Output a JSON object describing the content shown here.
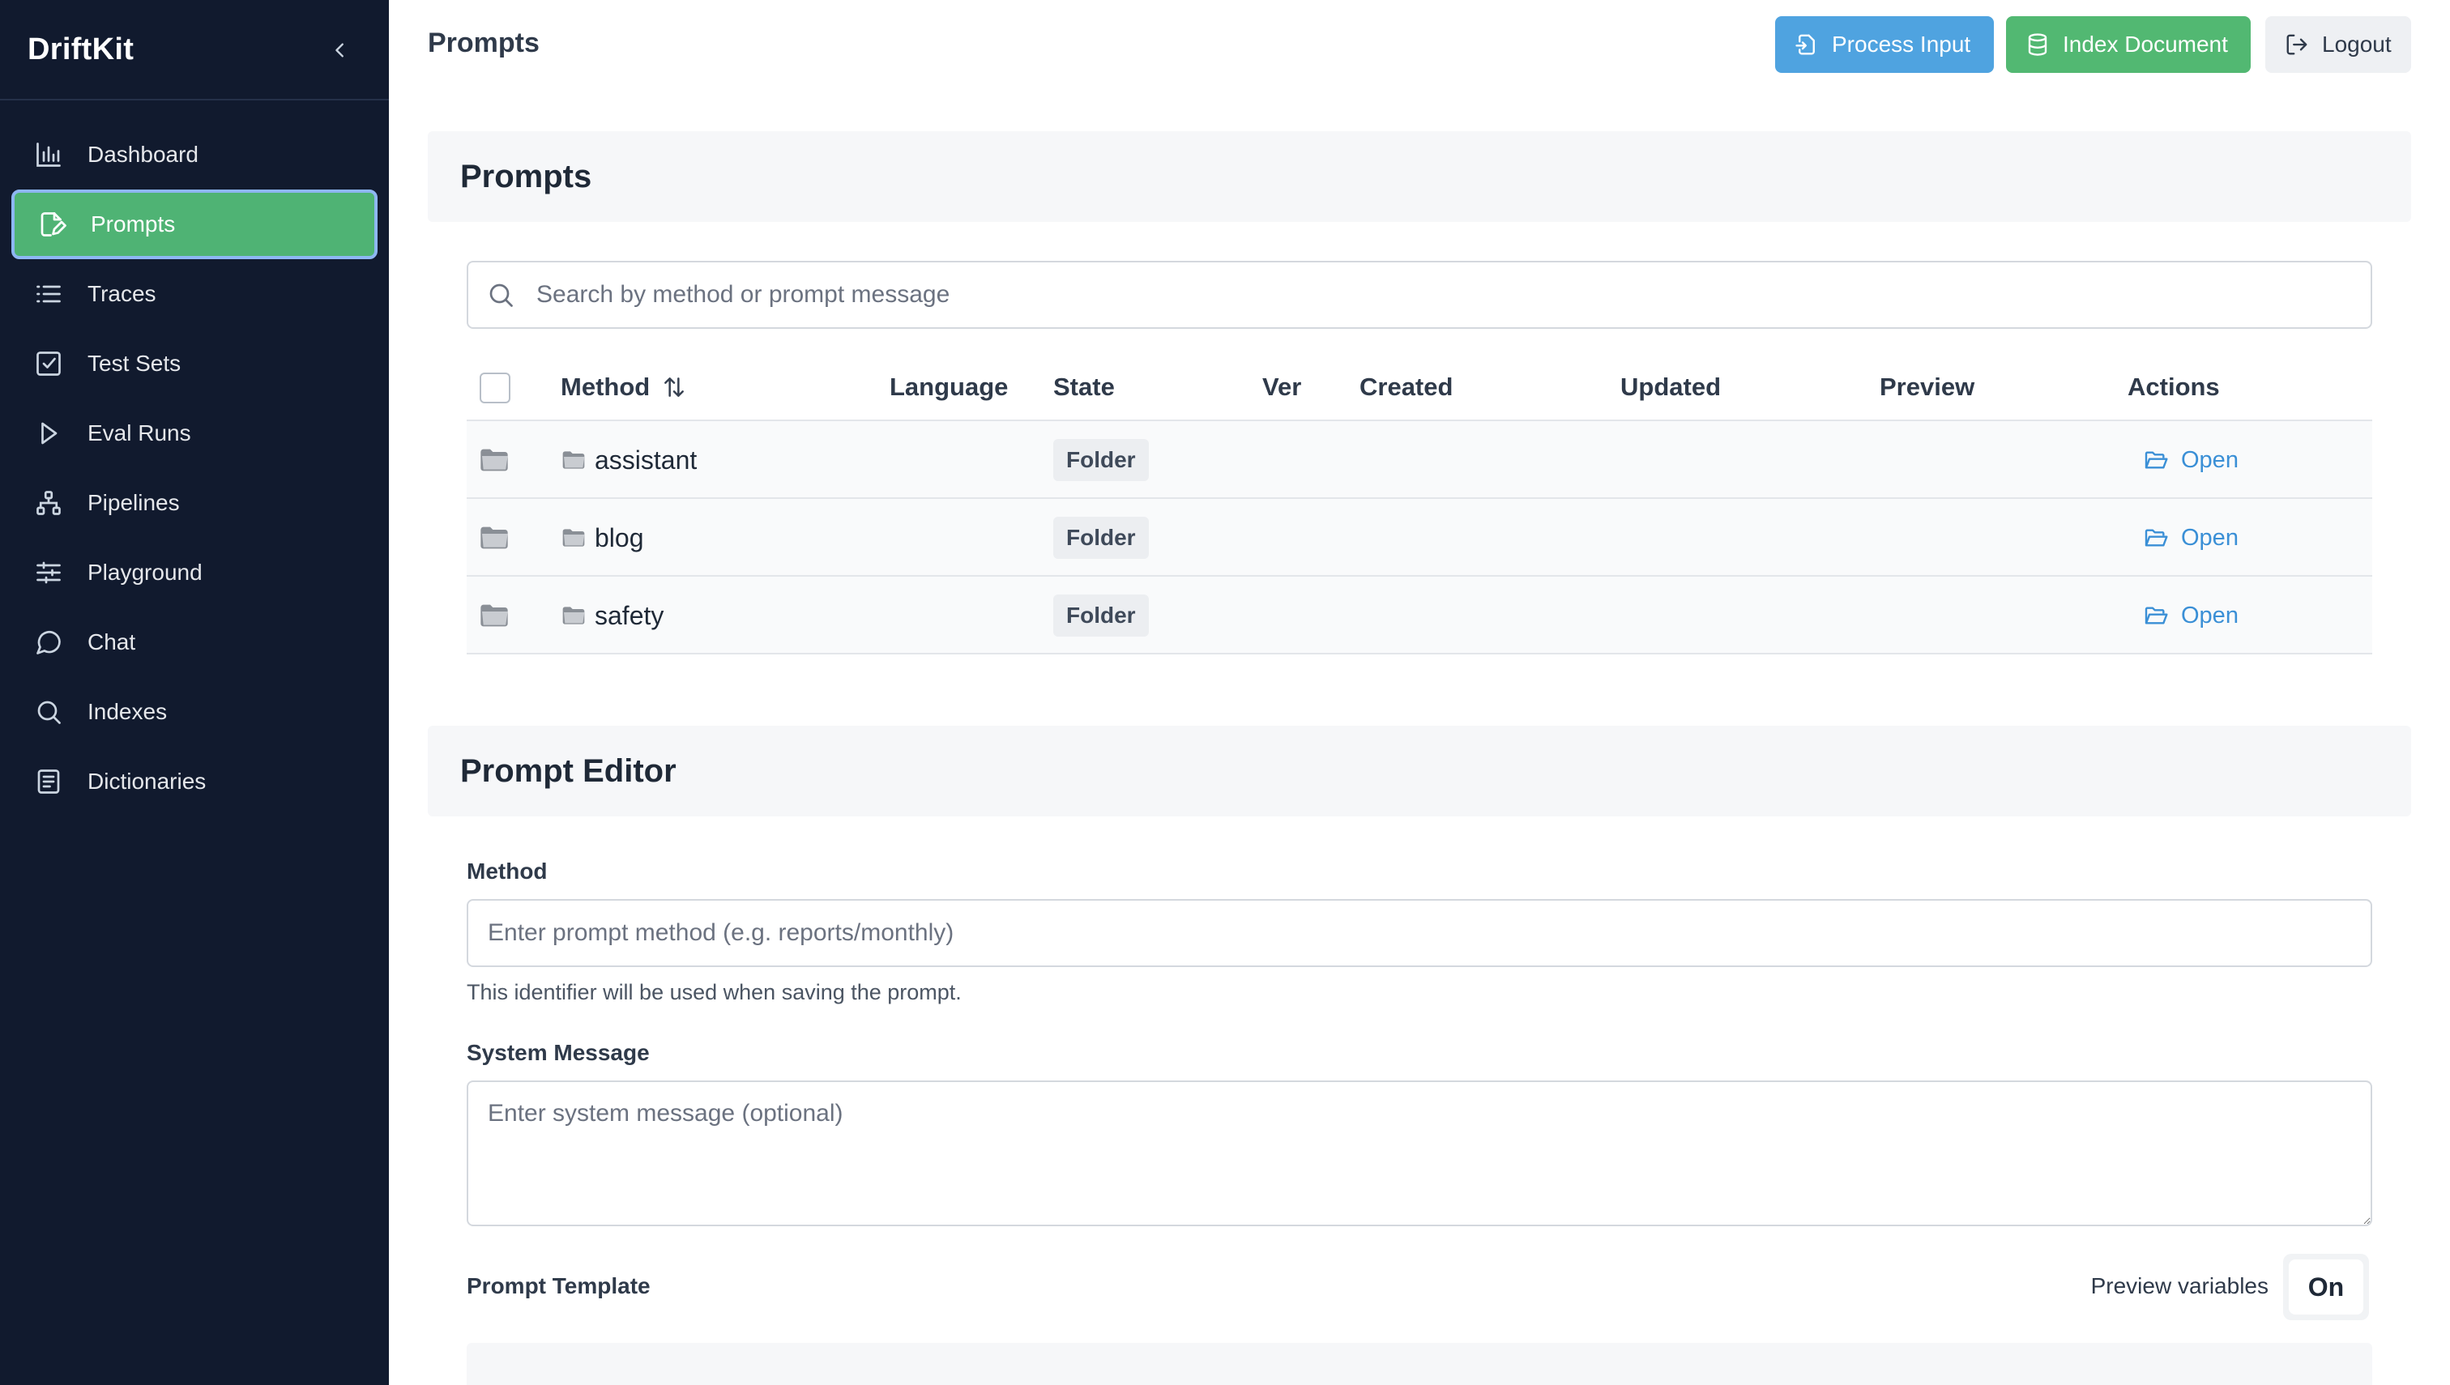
{
  "app": {
    "brand": "DriftKit"
  },
  "sidebar": {
    "items": [
      {
        "label": "Dashboard",
        "icon": "bar-chart-icon",
        "active": false
      },
      {
        "label": "Prompts",
        "icon": "edit-file-icon",
        "active": true
      },
      {
        "label": "Traces",
        "icon": "list-icon",
        "active": false
      },
      {
        "label": "Test Sets",
        "icon": "check-square-icon",
        "active": false
      },
      {
        "label": "Eval Runs",
        "icon": "play-icon",
        "active": false
      },
      {
        "label": "Pipelines",
        "icon": "sitemap-icon",
        "active": false
      },
      {
        "label": "Playground",
        "icon": "sliders-icon",
        "active": false
      },
      {
        "label": "Chat",
        "icon": "chat-icon",
        "active": false
      },
      {
        "label": "Indexes",
        "icon": "search-icon",
        "active": false
      },
      {
        "label": "Dictionaries",
        "icon": "book-icon",
        "active": false
      }
    ]
  },
  "header": {
    "title": "Prompts",
    "process_input": "Process Input",
    "index_document": "Index Document",
    "logout": "Logout"
  },
  "prompts_section": {
    "title": "Prompts",
    "search_placeholder": "Search by method or prompt message",
    "columns": {
      "method": "Method",
      "language": "Language",
      "state": "State",
      "ver": "Ver",
      "created": "Created",
      "updated": "Updated",
      "preview": "Preview",
      "actions": "Actions"
    },
    "rows": [
      {
        "method": "assistant",
        "state": "Folder",
        "action": "Open"
      },
      {
        "method": "blog",
        "state": "Folder",
        "action": "Open"
      },
      {
        "method": "safety",
        "state": "Folder",
        "action": "Open"
      }
    ]
  },
  "editor": {
    "title": "Prompt Editor",
    "method_label": "Method",
    "method_placeholder": "Enter prompt method (e.g. reports/monthly)",
    "method_help": "This identifier will be used when saving the prompt.",
    "system_label": "System Message",
    "system_placeholder": "Enter system message (optional)",
    "template_label": "Prompt Template",
    "preview_variables_label": "Preview variables",
    "preview_variables_value": "On"
  },
  "colors": {
    "sidebar_bg": "#111a2e",
    "active_green": "#4fb374",
    "process_blue": "#4fa3e0",
    "index_green": "#52b872",
    "link_blue": "#3a8fd6"
  }
}
